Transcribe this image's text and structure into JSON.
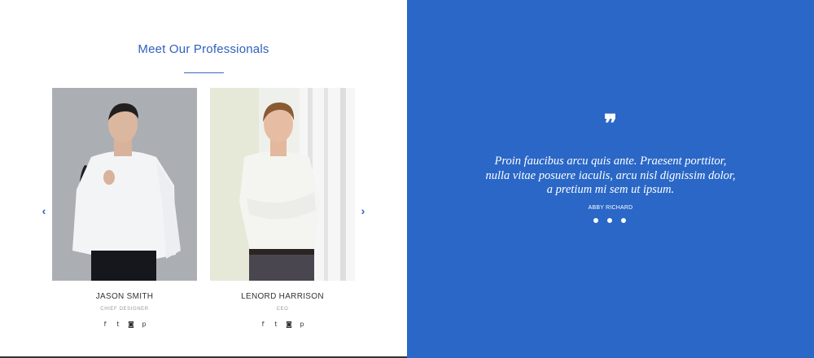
{
  "team": {
    "title": "Meet Our Professionals",
    "prev_arrow": "‹",
    "next_arrow": "›",
    "members": [
      {
        "name": "JASON SMITH",
        "role": "CHIEF DESIGNER"
      },
      {
        "name": "LENORD HARRISON",
        "role": "CEO"
      }
    ],
    "social_icons": [
      {
        "icon": "facebook-icon",
        "glyph": "f"
      },
      {
        "icon": "twitter-icon",
        "glyph": "t"
      },
      {
        "icon": "instagram-icon",
        "glyph": "◙"
      },
      {
        "icon": "pinterest-icon",
        "glyph": "p"
      }
    ]
  },
  "testimonial": {
    "quote_mark": "❞",
    "lines": [
      "Proin faucibus arcu quis ante. Praesent porttitor,",
      "nulla vitae posuere iaculis, arcu nisl dignissim dolor,",
      "a pretium mi sem ut ipsum."
    ],
    "author": "ABBY RICHARD",
    "slide_count": 3
  },
  "colors": {
    "accent": "#2f5fc0",
    "panel_background": "#2a67c6",
    "text_dark": "#333333",
    "text_muted": "#999999"
  }
}
